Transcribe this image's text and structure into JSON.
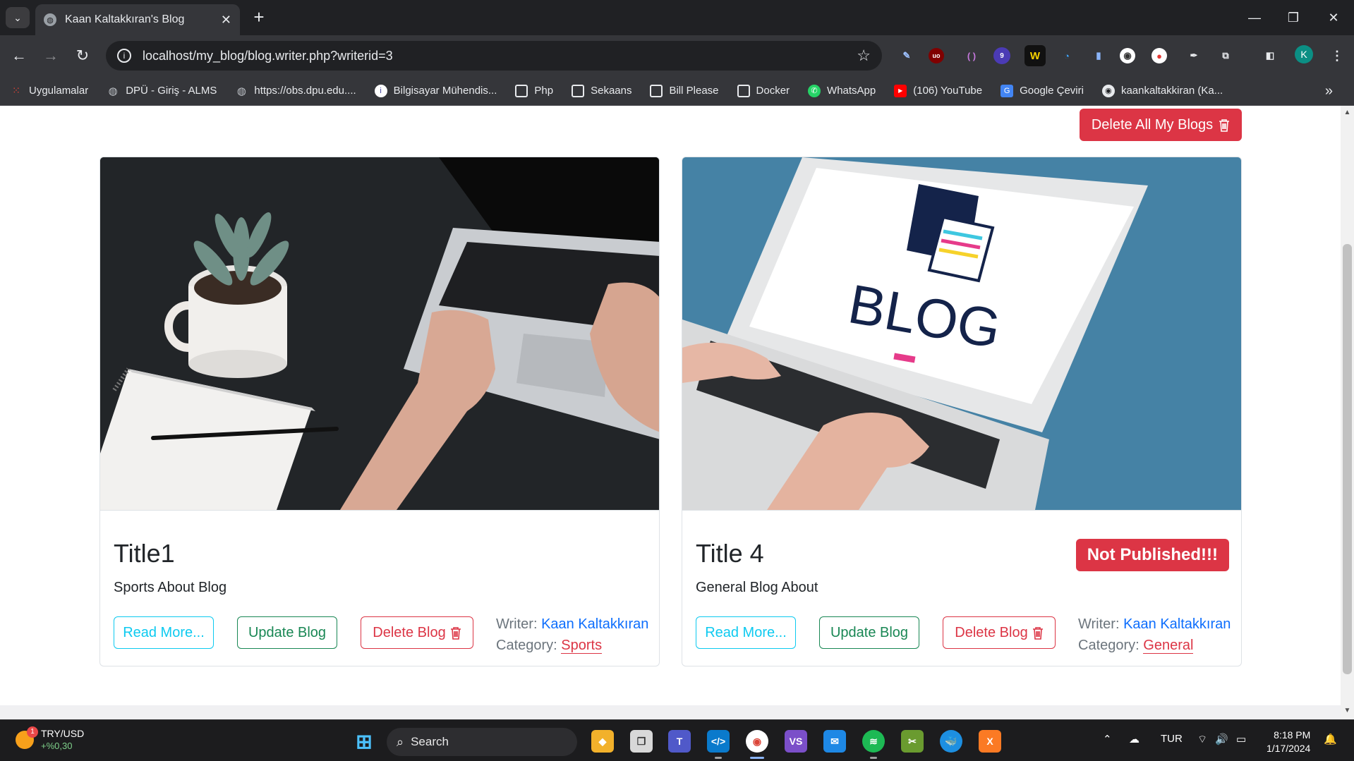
{
  "browser": {
    "tab_title": "Kaan Kaltakkıran's Blog",
    "url": "localhost/my_blog/blog.writer.php?writerid=3",
    "profile_initial": "K",
    "bookmarks": [
      {
        "label": "Uygulamalar",
        "icon": "apps-grid-icon"
      },
      {
        "label": "DPÜ - Giriş - ALMS",
        "icon": "globe-icon"
      },
      {
        "label": "https://obs.dpu.edu....",
        "icon": "globe-icon"
      },
      {
        "label": "Bilgisayar Mühendis...",
        "icon": "info-icon"
      },
      {
        "label": "Php",
        "icon": "folder-icon"
      },
      {
        "label": "Sekaans",
        "icon": "folder-icon"
      },
      {
        "label": "Bill Please",
        "icon": "folder-icon"
      },
      {
        "label": "Docker",
        "icon": "folder-icon"
      },
      {
        "label": "WhatsApp",
        "icon": "whatsapp-icon"
      },
      {
        "label": "(106) YouTube",
        "icon": "youtube-icon"
      },
      {
        "label": "Google Çeviri",
        "icon": "translate-icon"
      },
      {
        "label": "kaankaltakkiran (Ka...",
        "icon": "github-icon"
      }
    ],
    "extension_badge": "9"
  },
  "page": {
    "delete_all_label": "Delete All My Blogs",
    "cards": [
      {
        "title": "Title1",
        "text": "Sports About Blog",
        "read_more": "Read More...",
        "update": "Update Blog",
        "delete": "Delete Blog",
        "writer_label": "Writer:",
        "writer": "Kaan Kaltakkıran",
        "category_label": "Category:",
        "category": "Sports",
        "badge": ""
      },
      {
        "title": "Title 4",
        "text": "General Blog About",
        "read_more": "Read More...",
        "update": "Update Blog",
        "delete": "Delete Blog",
        "writer_label": "Writer:",
        "writer": "Kaan Kaltakkıran",
        "category_label": "Category:",
        "category": "General",
        "badge": "Not Published!!!"
      }
    ],
    "image_text": "BLOG"
  },
  "taskbar": {
    "weather_badge": "1",
    "currency": "TRY/USD",
    "change": "+%0,30",
    "search_label": "Search",
    "language": "TUR",
    "time": "8:18 PM",
    "date": "1/17/2024"
  },
  "colors": {
    "danger": "#dc3545",
    "success": "#198754",
    "info": "#0dcaf0",
    "primary": "#0d6efd"
  }
}
